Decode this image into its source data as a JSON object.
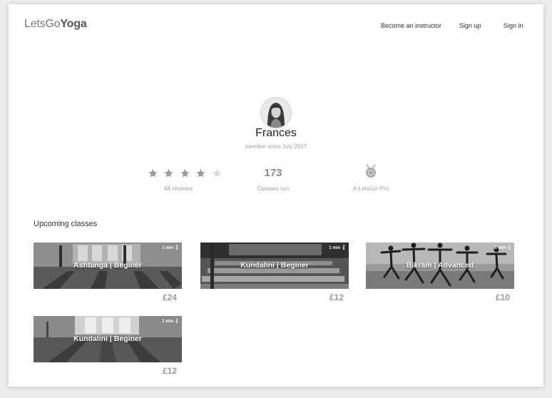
{
  "header": {
    "logo_light": "LetsGo",
    "logo_bold": "Yoga",
    "nav": [
      {
        "label": "Become an instructor"
      },
      {
        "label": "Sign up"
      },
      {
        "label": "Sign in"
      }
    ]
  },
  "profile": {
    "name": "Frances",
    "member_since": "member since July 2017",
    "rating": {
      "value": 4,
      "out_of": 5,
      "reviews_label": "48 reviews"
    },
    "classes_run": {
      "count": "173",
      "label": "Classes run"
    },
    "badge": {
      "label": "A LetsGo Pro",
      "icon": "medal-icon"
    }
  },
  "upcoming": {
    "title": "Upcoming classes",
    "classes": [
      {
        "title": "Ashtanga | Beginer",
        "duration": "1 min",
        "price": "£24"
      },
      {
        "title": "Kundalini | Beginer",
        "duration": "1 min",
        "price": "£12"
      },
      {
        "title": "Bikram | Advanced",
        "duration": "1 min",
        "price": "£10"
      },
      {
        "title": "Kundalini | Beginer",
        "duration": "1 min",
        "price": "£12"
      }
    ]
  },
  "colors": {
    "star_filled": "#9b9b9b",
    "star_empty": "#dcdcdc",
    "price": "#9a9a9a"
  }
}
